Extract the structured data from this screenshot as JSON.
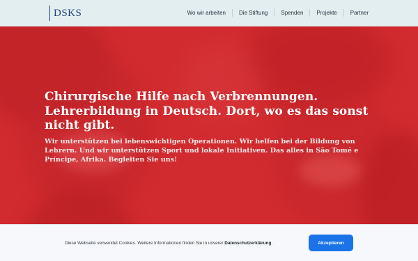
{
  "header": {
    "logo_text": "DSKS",
    "nav": [
      {
        "label": "Wo wir arbeiten"
      },
      {
        "label": "Die Stiftung"
      },
      {
        "label": "Spenden"
      },
      {
        "label": "Projekte"
      },
      {
        "label": "Partner"
      }
    ]
  },
  "hero": {
    "headline": "Chirurgische Hilfe nach Verbrennungen. Lehrerbildung in Deutsch. Dort, wo es das sonst nicht gibt.",
    "subline": "Wir unterstützen bei lebenswichtigen Operationen. Wir helfen bei der Bildung von Lehrern. Und wir unterstützen Sport und lokale Initiativen. Das alles in São Tomé e Príncipe, Afrika. Begleiten Sie uns!",
    "overlay_color": "#d12b2f"
  },
  "cookie": {
    "text": "Diese Webseite verwendet Cookies. Weitere Informationen finden Sie in unserer ",
    "link_label": "Datenschutzerklärung",
    "text_end": ".",
    "accept_label": "Akzeptieren",
    "accent_color": "#1a73e8"
  }
}
